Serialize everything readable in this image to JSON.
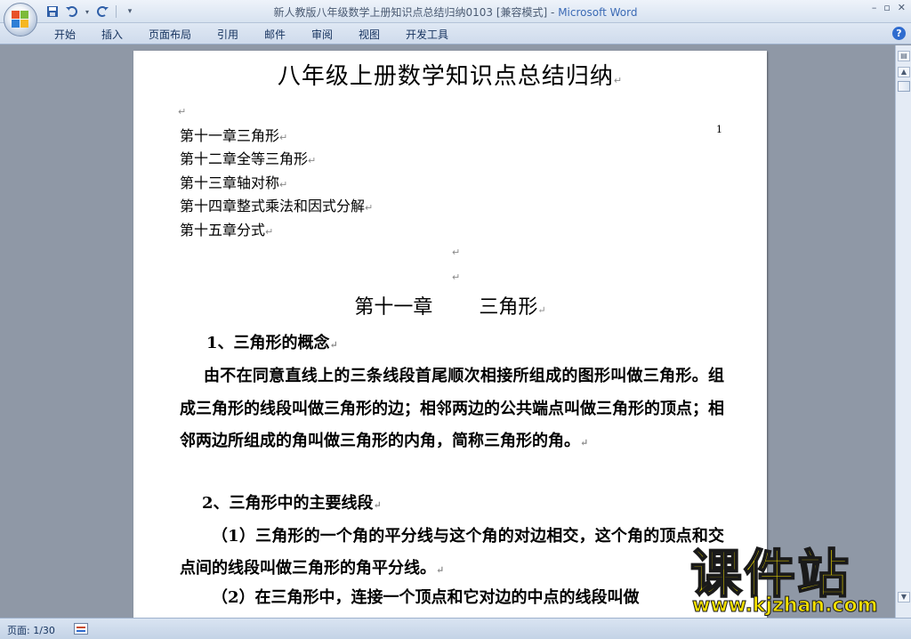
{
  "window": {
    "title_doc": "新人教版八年级数学上册知识点总结归纳0103 [兼容模式] - ",
    "title_app": "Microsoft Word",
    "controls": [
      "–",
      "▫",
      "✕"
    ]
  },
  "quick_access": {
    "items": [
      "save-icon",
      "undo-icon",
      "redo-icon",
      "customize-icon"
    ]
  },
  "ribbon": {
    "tabs": [
      "开始",
      "插入",
      "页面布局",
      "引用",
      "邮件",
      "审阅",
      "视图",
      "开发工具"
    ],
    "help": "?"
  },
  "document": {
    "title": "八年级上册数学知识点总结归纳",
    "page_number": "1",
    "toc": [
      "第十一章三角形",
      "第十二章全等三角形",
      "第十三章轴对称",
      "第十四章整式乘法和因式分解",
      "第十五章分式"
    ],
    "chapter_left": "第十一章",
    "chapter_right": "三角形",
    "section1_heading": "1、三角形的概念",
    "section1_text": "由不在同意直线上的三条线段首尾顺次相接所组成的图形叫做三角形。组成三角形的线段叫做三角形的边；相邻两边的公共端点叫做三角形的顶点；相邻两边所组成的角叫做三角形的内角，简称三角形的角。",
    "section2_heading": "2、三角形中的主要线段",
    "section2_item1": "（1）三角形的一个角的平分线与这个角的对边相交，这个角的顶点和交点间的线段叫做三角形的角平分线。",
    "section2_item2": "（2）在三角形中，连接一个顶点和它对边的中点的线段叫做",
    "para_mark": "↵"
  },
  "status": {
    "page": "页面: 1/30"
  },
  "watermark": {
    "main": "课件站",
    "url": "www.kjzhan.com"
  }
}
